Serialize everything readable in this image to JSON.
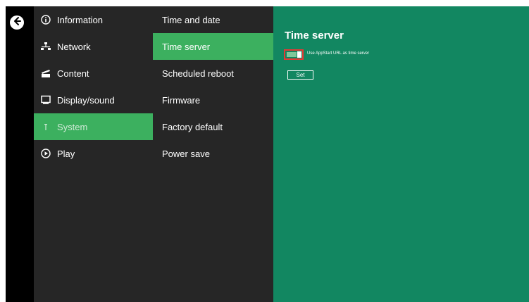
{
  "nav": {
    "back_icon": "back-arrow-icon",
    "primary": [
      {
        "label": "Information",
        "icon": "info-icon",
        "active": false
      },
      {
        "label": "Network",
        "icon": "network-icon",
        "active": false
      },
      {
        "label": "Content",
        "icon": "content-icon",
        "active": false
      },
      {
        "label": "Display/sound",
        "icon": "display-icon",
        "active": false
      },
      {
        "label": "System",
        "icon": "system-icon",
        "active": true
      },
      {
        "label": "Play",
        "icon": "play-icon",
        "active": false
      }
    ],
    "secondary": [
      {
        "label": "Time and date",
        "active": false
      },
      {
        "label": "Time server",
        "active": true
      },
      {
        "label": "Scheduled reboot",
        "active": false
      },
      {
        "label": "Firmware",
        "active": false
      },
      {
        "label": "Factory default",
        "active": false
      },
      {
        "label": "Power save",
        "active": false
      }
    ]
  },
  "panel": {
    "title": "Time server",
    "toggle_label": "Use AppStart URL as time server",
    "toggle_on": true,
    "set_label": "Set"
  },
  "colors": {
    "accent": "#3cb05f",
    "panel_bg": "#128761",
    "menu_bg": "#262626",
    "highlight": "#e53935"
  }
}
